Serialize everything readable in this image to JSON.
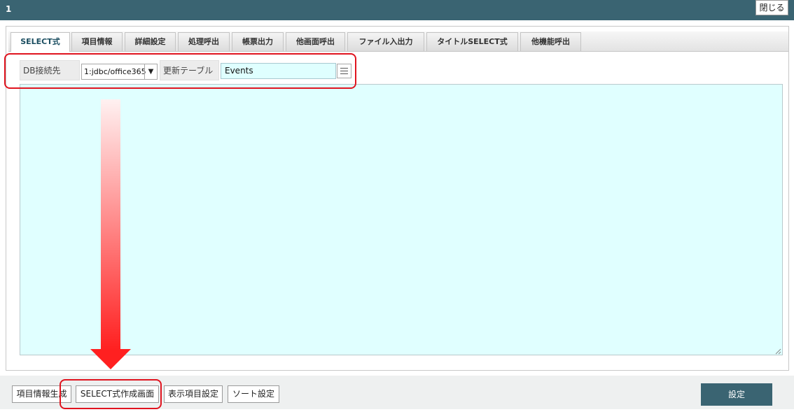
{
  "window": {
    "title": "1",
    "close_label": "閉じる"
  },
  "tabs": [
    {
      "label": "SELECT式",
      "active": true
    },
    {
      "label": "項目情報"
    },
    {
      "label": "詳細設定"
    },
    {
      "label": "処理呼出"
    },
    {
      "label": "帳票出力"
    },
    {
      "label": "他画面呼出"
    },
    {
      "label": "ファイル入出力"
    },
    {
      "label": "タイトルSELECT式"
    },
    {
      "label": "他機能呼出"
    }
  ],
  "db": {
    "connection_label": "DB接続先",
    "connection_value": "1:jdbc/office365",
    "table_label": "更新テーブル",
    "table_value": "Events"
  },
  "sql_text": "",
  "bottom": {
    "buttons": [
      "項目情報生成",
      "SELECT式作成画面",
      "表示項目設定",
      "ソート設定"
    ],
    "set_label": "設定"
  },
  "colors": {
    "titlebar": "#3a6472",
    "input_bg": "#e0ffff",
    "annotation": "#e0141f"
  }
}
